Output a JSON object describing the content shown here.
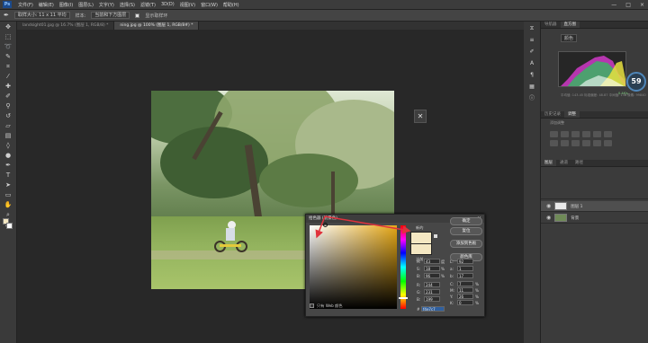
{
  "menu": [
    "文件(F)",
    "编辑(E)",
    "图像(I)",
    "图层(L)",
    "文字(Y)",
    "选择(S)",
    "滤镜(T)",
    "3D(D)",
    "视图(V)",
    "窗口(W)",
    "帮助(H)"
  ],
  "window_controls": [
    "—",
    "□",
    "×"
  ],
  "options_bar": {
    "sample_size": "取样大小: 11 x 11 平均",
    "sample_label": "样本:",
    "sample_value": "当前和下方图层",
    "show_ring": "显示取样环"
  },
  "tabs": [
    {
      "label": "landsight01.jpg @ 16.7% (图层 1, RGB/8) *"
    },
    {
      "label": "ning.jpg @ 100% (图层 1, RGB/8#) *"
    }
  ],
  "right_panel": {
    "tabs_top": [
      "导航器",
      "直方图"
    ],
    "histo_channel": "颜色",
    "histo_rows": "平均值: 143.45  标准偏差: 48.87  中间值: 138  像素: 99840",
    "gauge_value": "59",
    "gauge_sub": "0.4K/s",
    "adj_tabs": [
      "历史记录",
      "调整"
    ],
    "adj_title": "添加调整",
    "layer_tabs": [
      "图层",
      "通道",
      "路径"
    ],
    "layers": [
      {
        "name": "图层 1"
      },
      {
        "name": "背景"
      }
    ]
  },
  "picker": {
    "title": "拾色器 (前景色)",
    "close": "×",
    "btn_ok": "确定",
    "btn_cancel": "复位",
    "btn_add": "添加到色板",
    "btn_lib": "颜色库",
    "new_label": "新的",
    "current_label": "当前",
    "web_only": "只有 Web 颜色",
    "H": {
      "label": "H:",
      "value": "43",
      "unit": "度"
    },
    "S": {
      "label": "S:",
      "value": "18",
      "unit": "%"
    },
    "B": {
      "label": "B:",
      "value": "96",
      "unit": "%"
    },
    "R": {
      "label": "R:",
      "value": "244",
      "unit": ""
    },
    "G": {
      "label": "G:",
      "value": "231",
      "unit": ""
    },
    "Bb": {
      "label": "B:",
      "value": "199",
      "unit": ""
    },
    "L": {
      "label": "L:",
      "value": "92",
      "unit": ""
    },
    "a": {
      "label": "a:",
      "value": "1",
      "unit": ""
    },
    "b": {
      "label": "b:",
      "value": "17",
      "unit": ""
    },
    "C": {
      "label": "C:",
      "value": "7",
      "unit": "%"
    },
    "M": {
      "label": "M:",
      "value": "11",
      "unit": "%"
    },
    "Y": {
      "label": "Y:",
      "value": "26",
      "unit": "%"
    },
    "K": {
      "label": "K:",
      "value": "0",
      "unit": "%"
    },
    "hex_label": "#",
    "hex_value": "f4e7c7"
  },
  "colors": {
    "accent": "#e0323c",
    "swatch": "#f4e7c2"
  }
}
